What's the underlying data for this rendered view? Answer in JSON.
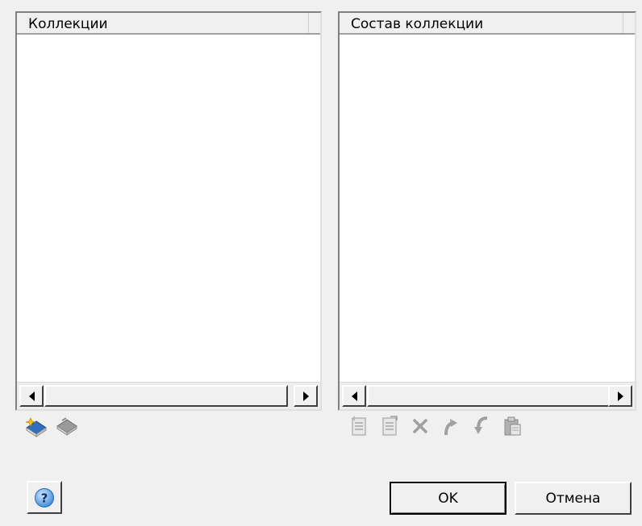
{
  "left_panel": {
    "header": "Коллекции",
    "toolbar": {
      "icons": [
        "new-collection-icon",
        "delete-collection-icon"
      ]
    }
  },
  "right_panel": {
    "header": "Состав коллекции",
    "toolbar": {
      "icons": [
        "add-item-icon",
        "edit-item-icon",
        "delete-item-icon",
        "move-up-icon",
        "move-down-icon",
        "paste-icon"
      ]
    }
  },
  "buttons": {
    "ok": "OK",
    "cancel": "Отмена",
    "help": "?"
  }
}
